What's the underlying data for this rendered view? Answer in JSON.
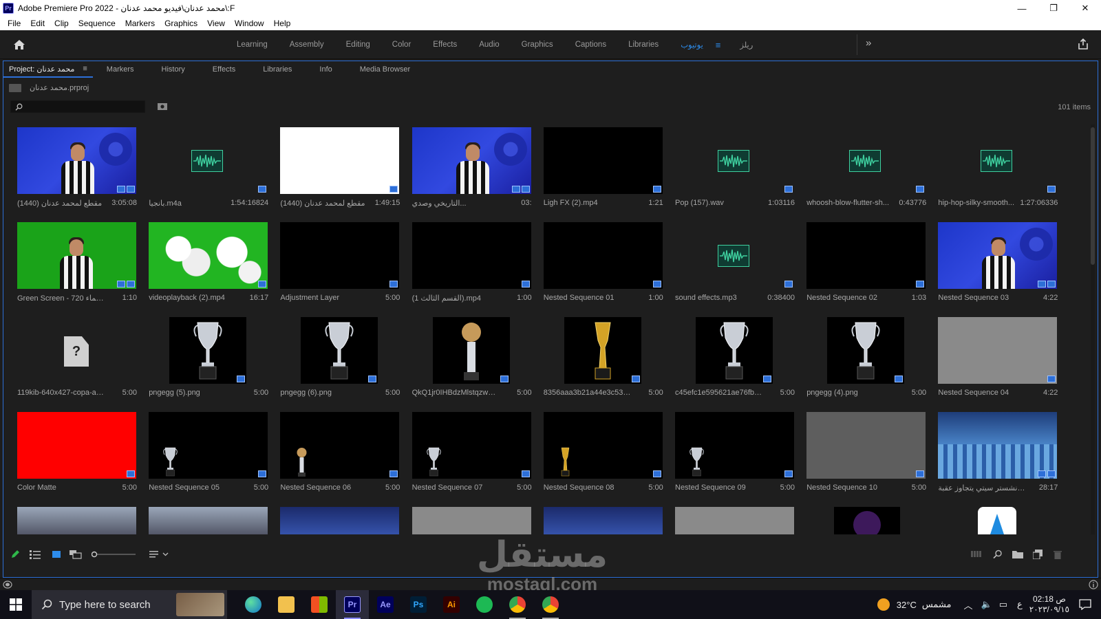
{
  "window": {
    "app_name": "Adobe Premiere Pro 2022",
    "title_sep": " - ",
    "file_path": "F:\\محمد عدنان\\فيديو محمد عدنان",
    "badge": "Pr",
    "minimize": "—",
    "maximize": "❐",
    "close": "✕"
  },
  "menu": [
    "File",
    "Edit",
    "Clip",
    "Sequence",
    "Markers",
    "Graphics",
    "View",
    "Window",
    "Help"
  ],
  "workspace": {
    "tabs": [
      "Learning",
      "Assembly",
      "Editing",
      "Color",
      "Effects",
      "Audio",
      "Graphics",
      "Captions",
      "Libraries",
      "يوتيوب",
      "ريلز"
    ],
    "active": "يوتيوب",
    "menu_icon": "≡",
    "more": "»"
  },
  "panel": {
    "tabs": [
      "Project: محمد عدنان",
      "Markers",
      "History",
      "Effects",
      "Libraries",
      "Info",
      "Media Browser"
    ],
    "active_tab": "Project: محمد عدنان",
    "tab_menu": "≡",
    "project_file": "محمد عدنان.prproj",
    "search_placeholder": "",
    "items_count": "101 items"
  },
  "bins": [
    {
      "name": "مقطع لمحمد عدنان (1440)",
      "duration": "3:05:08",
      "thumb": "blue-person"
    },
    {
      "name": "بانجيا.m4a",
      "duration": "1:54:16824",
      "thumb": "audio"
    },
    {
      "name": "مقطع لمحمد عدنان (1440)",
      "duration": "1:49:15",
      "thumb": "white"
    },
    {
      "name": "التاريخي وصدي...",
      "duration": "03:",
      "thumb": "blue-person"
    },
    {
      "name": "Ligh FX (2).mp4",
      "duration": "1:21",
      "thumb": "black"
    },
    {
      "name": "Pop (157).wav",
      "duration": "1:03116",
      "thumb": "audio"
    },
    {
      "name": "whoosh-blow-flutter-sh...",
      "duration": "0:43776",
      "thumb": "audio"
    },
    {
      "name": "hip-hop-silky-smooth...",
      "duration": "1:27:06336",
      "thumb": "audio"
    },
    {
      "name": "Green Screen - 720 السماء...",
      "duration": "1:10",
      "thumb": "green-person"
    },
    {
      "name": "videoplayback (2).mp4",
      "duration": "16:17",
      "thumb": "clouds"
    },
    {
      "name": "Adjustment Layer",
      "duration": "5:00",
      "thumb": "black"
    },
    {
      "name": "(القسم الثالث 1).mp4",
      "duration": "1:00",
      "thumb": "black"
    },
    {
      "name": "Nested Sequence 01",
      "duration": "1:00",
      "thumb": "black"
    },
    {
      "name": "sound effects.mp3",
      "duration": "0:38400",
      "thumb": "audio"
    },
    {
      "name": "Nested Sequence 02",
      "duration": "1:03",
      "thumb": "black"
    },
    {
      "name": "Nested Sequence 03",
      "duration": "4:22",
      "thumb": "blue-person"
    },
    {
      "name": "119kib-640x427-copa-amer...",
      "duration": "5:00",
      "thumb": "unknown"
    },
    {
      "name": "pngegg (5).png",
      "duration": "5:00",
      "thumb": "trophy-silver"
    },
    {
      "name": "pngegg (6).png",
      "duration": "5:00",
      "thumb": "trophy-silver"
    },
    {
      "name": "QkQ1jr0IHBdzMlstqzwM0...",
      "duration": "5:00",
      "thumb": "trophy-ball"
    },
    {
      "name": "8356aaa3b21a44e3c5323c0...",
      "duration": "5:00",
      "thumb": "trophy-gold"
    },
    {
      "name": "c45efc1e595621ae76fb6d1e...",
      "duration": "5:00",
      "thumb": "trophy-silver"
    },
    {
      "name": "pngegg (4).png",
      "duration": "5:00",
      "thumb": "trophy-silver"
    },
    {
      "name": "Nested Sequence 04",
      "duration": "4:22",
      "thumb": "gray"
    },
    {
      "name": "Color Matte",
      "duration": "5:00",
      "thumb": "red"
    },
    {
      "name": "Nested Sequence 05",
      "duration": "5:00",
      "thumb": "trophy-silver-small"
    },
    {
      "name": "Nested Sequence 06",
      "duration": "5:00",
      "thumb": "trophy-ball-small"
    },
    {
      "name": "Nested Sequence 07",
      "duration": "5:00",
      "thumb": "trophy-silver-small"
    },
    {
      "name": "Nested Sequence 08",
      "duration": "5:00",
      "thumb": "trophy-gold-small"
    },
    {
      "name": "Nested Sequence 09",
      "duration": "5:00",
      "thumb": "trophy-silver-small"
    },
    {
      "name": "Nested Sequence 10",
      "duration": "5:00",
      "thumb": "dgray"
    },
    {
      "name": "مانشستر سيتي يتجاوز عقبة |...",
      "duration": "28:17",
      "thumb": "city"
    },
    {
      "name": "",
      "duration": "",
      "thumb": "stadium"
    },
    {
      "name": "",
      "duration": "",
      "thumb": "stadium"
    },
    {
      "name": "",
      "duration": "",
      "thumb": "crowd"
    },
    {
      "name": "",
      "duration": "",
      "thumb": "gray"
    },
    {
      "name": "",
      "duration": "",
      "thumb": "crowd"
    },
    {
      "name": "",
      "duration": "",
      "thumb": "gray"
    },
    {
      "name": "",
      "duration": "",
      "thumb": "purple"
    },
    {
      "name": "",
      "duration": "",
      "thumb": "white-logo"
    }
  ],
  "taskbar": {
    "search_placeholder": "Type here to search",
    "apps": [
      "edge",
      "explorer",
      "store",
      "Pr",
      "Ae",
      "Ps",
      "Ai",
      "spotify",
      "chrome",
      "chrome-2"
    ],
    "weather_temp": "32°C",
    "weather_label": "مشمس",
    "language": "ع",
    "time": "02:18 ص",
    "date": "٢٠٢٣/٠٩/١٥"
  },
  "watermark": {
    "title": "مستقل",
    "domain": "mostaql.com"
  },
  "colors": {
    "accent": "#2d8ceb",
    "panel_border": "#2d6fd8",
    "audio": "#3fd1a0"
  }
}
